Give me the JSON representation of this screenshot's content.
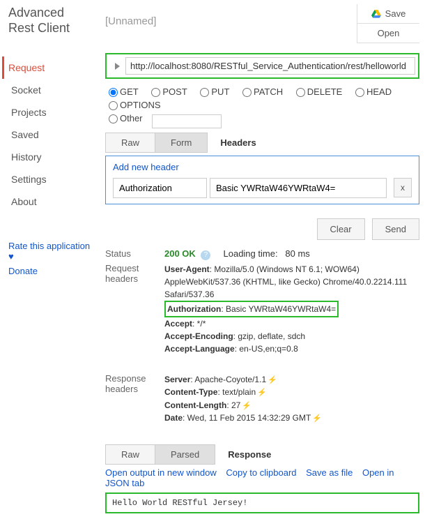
{
  "app": {
    "title": "Advanced Rest Client"
  },
  "topbar": {
    "unnamed": "[Unnamed]",
    "save": "Save",
    "open": "Open"
  },
  "url": "http://localhost:8080/RESTful_Service_Authentication/rest/helloworld",
  "methods": {
    "get": "GET",
    "post": "POST",
    "put": "PUT",
    "patch": "PATCH",
    "delete": "DELETE",
    "head": "HEAD",
    "options": "OPTIONS",
    "other": "Other"
  },
  "nav": {
    "request": "Request",
    "socket": "Socket",
    "projects": "Projects",
    "saved": "Saved",
    "history": "History",
    "settings": "Settings",
    "about": "About"
  },
  "footer": {
    "rate": "Rate this application ♥",
    "donate": "Donate"
  },
  "tabs": {
    "raw": "Raw",
    "form": "Form",
    "headers_title": "Headers",
    "parsed": "Parsed",
    "response_title": "Response"
  },
  "headers_form": {
    "add": "Add new header",
    "name": "Authorization",
    "value": "Basic YWRtaW46YWRtaW4=",
    "x": "x"
  },
  "actions": {
    "clear": "Clear",
    "send": "Send"
  },
  "status": {
    "label": "Status",
    "code": "200 OK",
    "loading_label": "Loading time:",
    "loading_value": "80 ms"
  },
  "req_hdr": {
    "label": "Request headers",
    "ua_k": "User-Agent",
    "ua_v": ": Mozilla/5.0 (Windows NT 6.1; WOW64) AppleWebKit/537.36 (KHTML, like Gecko) Chrome/40.0.2214.111 Safari/537.36",
    "auth_k": "Authorization",
    "auth_v": ": Basic YWRtaW46YWRtaW4=",
    "accept_k": "Accept",
    "accept_v": ": */*",
    "enc_k": "Accept-Encoding",
    "enc_v": ": gzip, deflate, sdch",
    "lang_k": "Accept-Language",
    "lang_v": ": en-US,en;q=0.8"
  },
  "resp_hdr": {
    "label": "Response headers",
    "server_k": "Server",
    "server_v": ": Apache-Coyote/1.1",
    "ct_k": "Content-Type",
    "ct_v": ": text/plain",
    "cl_k": "Content-Length",
    "cl_v": ": 27",
    "date_k": "Date",
    "date_v": ": Wed, 11 Feb 2015 14:32:29 GMT"
  },
  "resp_links": {
    "new_window": "Open output in new window",
    "copy": "Copy to clipboard",
    "save_file": "Save as file",
    "json_tab": "Open in JSON tab"
  },
  "response_body": "Hello World RESTful Jersey!"
}
